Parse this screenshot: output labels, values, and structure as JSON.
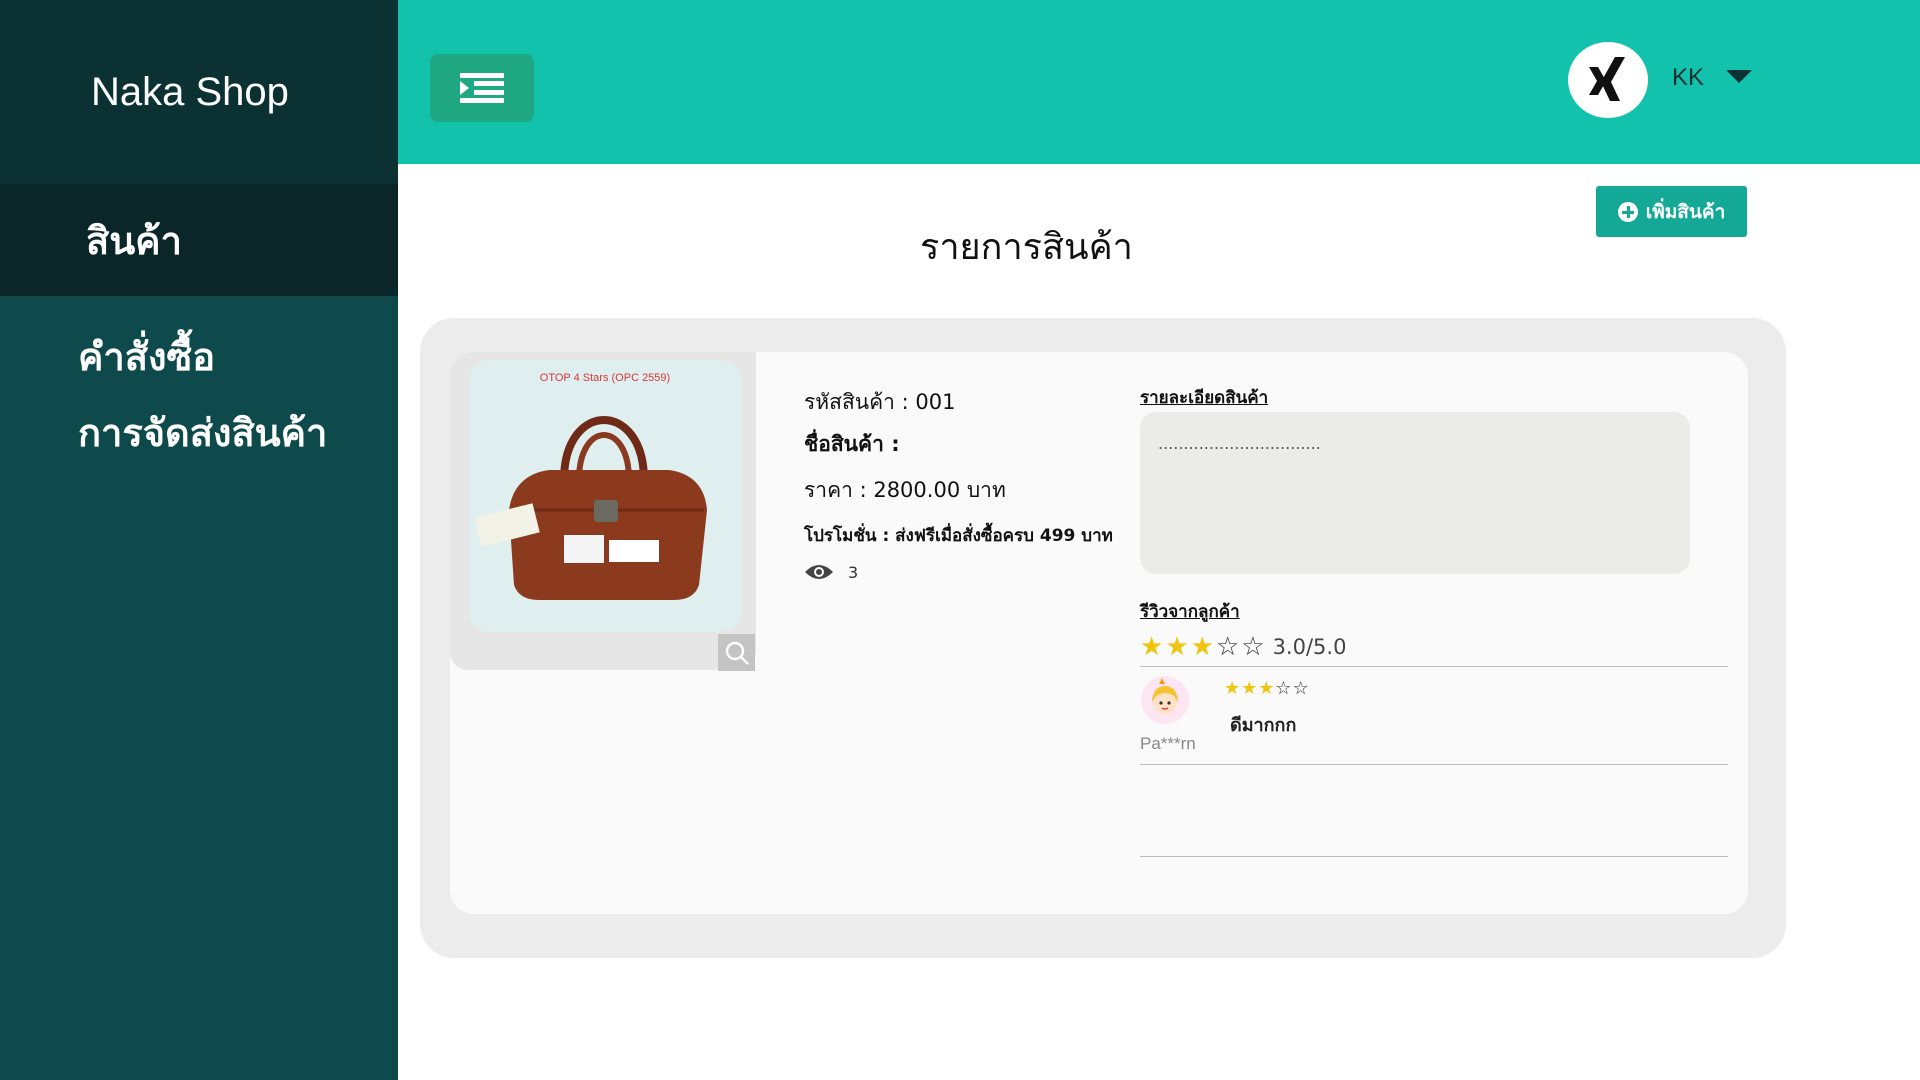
{
  "brand": {
    "title": "Naka Shop"
  },
  "sidebar": {
    "items": [
      {
        "label": "สินค้า"
      },
      {
        "label": "คำสั่งซื้อ"
      },
      {
        "label": "การจัดส่งสินค้า"
      }
    ]
  },
  "header": {
    "user": "KK",
    "avatar_icon": "xing-icon"
  },
  "main": {
    "title": "รายการสินค้า",
    "add_button": "เพิ่มสินค้า"
  },
  "product": {
    "image_caption": "OTOP 4 Stars (OPC 2559)",
    "code_line": "รหัสสินค้า : 001",
    "name_line": "ชื่อสินค้า :",
    "price_line": "ราคา : 2800.00  บาท",
    "promo_line": "โปรโมชั่น : ส่งฟรีเมื่อสั่งซื้อครบ 499 บาท",
    "views": "3",
    "detail_label": "รายละเอียดสินค้า",
    "detail_text": "................................",
    "review_label": "รีวิวจากลูกค้า",
    "rating_text": "3.0/5.0",
    "rating": 3,
    "rating_max": 5
  },
  "reviews": [
    {
      "user": "Pa***rn",
      "rating": 3,
      "text": "ดีมากกก"
    }
  ],
  "colors": {
    "sidebar": "#0e4a4c",
    "sidebar_dark": "#0b3133",
    "topbar": "#13c2ad",
    "accent_button": "#13a996",
    "star": "#f1c40f"
  }
}
